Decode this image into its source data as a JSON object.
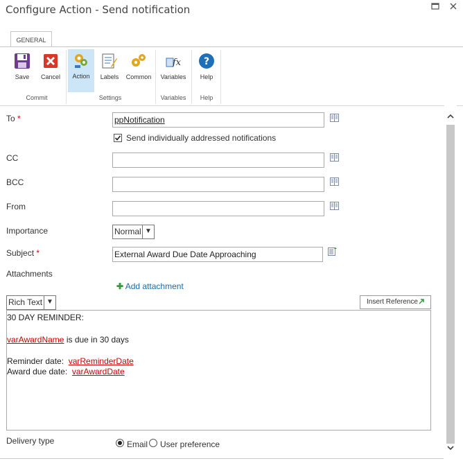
{
  "window": {
    "title": "Configure Action - Send notification"
  },
  "ribbon": {
    "tab": "GENERAL",
    "groups": {
      "commit": "Commit",
      "settings": "Settings",
      "variables": "Variables",
      "help": "Help"
    },
    "buttons": {
      "save": "Save",
      "cancel": "Cancel",
      "action": "Action",
      "labels": "Labels",
      "common": "Common",
      "variables": "Variables",
      "help": "Help"
    }
  },
  "form": {
    "to": {
      "label": "To",
      "required": "*",
      "value": "ppNotification"
    },
    "send_individually": {
      "label": "Send individually addressed notifications",
      "checked": true
    },
    "cc": {
      "label": "CC",
      "value": ""
    },
    "bcc": {
      "label": "BCC",
      "value": ""
    },
    "from": {
      "label": "From",
      "value": ""
    },
    "importance": {
      "label": "Importance",
      "value": "Normal"
    },
    "subject": {
      "label": "Subject",
      "required": "*",
      "value": "External Award Due Date Approaching"
    },
    "attachments": {
      "label": "Attachments",
      "add": "Add attachment"
    },
    "format": {
      "value": "Rich Text"
    },
    "insert_reference": "Insert Reference",
    "body": {
      "heading": "30 DAY REMINDER:",
      "var_award_name": "varAwardName",
      "due_text": "is due in 30 days",
      "reminder_label": "Reminder date:",
      "var_reminder_date": "varReminderDate",
      "award_due_label": "Award due date:",
      "var_award_date": "varAwardDate"
    },
    "delivery": {
      "label": "Delivery type",
      "options": [
        "Email",
        "User preference"
      ],
      "selected": "Email"
    }
  }
}
